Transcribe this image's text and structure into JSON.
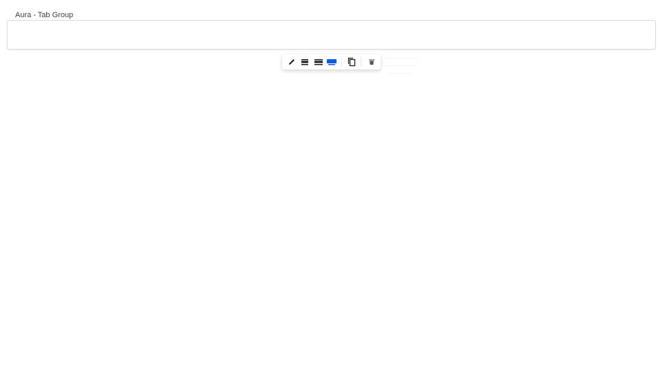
{
  "component": {
    "label": "Aura - Tab Group"
  },
  "toolbar": {
    "buttons": [
      {
        "icon": "pencil-icon",
        "name": "edit-button"
      },
      {
        "icon": "layout-narrow-icon",
        "name": "width-narrow-button"
      },
      {
        "icon": "layout-medium-icon",
        "name": "width-medium-button"
      },
      {
        "icon": "layout-full-icon",
        "name": "width-full-button",
        "active": true
      },
      {
        "icon": "copy-icon",
        "name": "duplicate-button"
      },
      {
        "icon": "trash-icon",
        "name": "delete-button"
      }
    ],
    "colors": {
      "icon": "#1b1b1b",
      "active": "#0b5cde"
    }
  }
}
